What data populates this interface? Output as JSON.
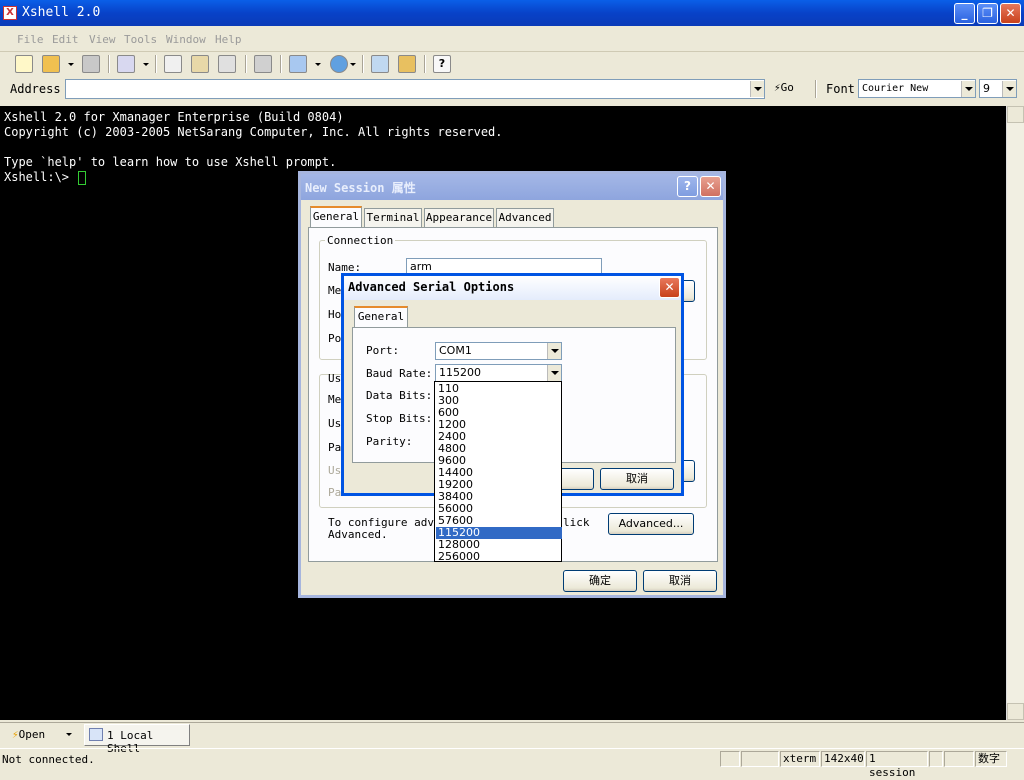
{
  "app": {
    "title": "Xshell 2.0"
  },
  "menu": [
    "File",
    "Edit",
    "View",
    "Tools",
    "Window",
    "Help"
  ],
  "address": {
    "label": "Address",
    "value": "",
    "go_label": "Go",
    "font_label": "Font",
    "font_value": "Courier New",
    "size_value": "9"
  },
  "terminal": {
    "lines": [
      "Xshell 2.0 for Xmanager Enterprise (Build 0804)",
      "Copyright (c) 2003-2005 NetSarang Computer, Inc. All rights reserved.",
      "",
      "Type `help' to learn how to use Xshell prompt.",
      "Xshell:\\> "
    ]
  },
  "session_dialog": {
    "title": "New Session 属性",
    "tabs": [
      "General",
      "Terminal",
      "Appearance",
      "Advanced"
    ],
    "connection_label": "Connection",
    "name_label": "Name:",
    "name_value": "arm",
    "trunc_labels": [
      "Me",
      "Ho",
      "Po",
      "Us",
      "Me",
      "Us",
      "Pa",
      "Us",
      "Pa"
    ],
    "configure_text_1": "To configure advan",
    "configure_text_2": "Advanced.",
    "configure_text_right": "lick",
    "advanced_button": "Advanced...",
    "ok_button": "确定",
    "cancel_button": "取消"
  },
  "serial_dialog": {
    "title": "Advanced Serial Options",
    "tab": "General",
    "port_label": "Port:",
    "port_value": "COM1",
    "baud_label": "Baud Rate:",
    "baud_value": "115200",
    "data_bits_label": "Data Bits:",
    "stop_bits_label": "Stop Bits:",
    "parity_label": "Parity:",
    "ok_partial": "E",
    "cancel_button": "取消",
    "baud_options": [
      "110",
      "300",
      "600",
      "1200",
      "2400",
      "4800",
      "9600",
      "14400",
      "19200",
      "38400",
      "56000",
      "57600",
      "115200",
      "128000",
      "256000"
    ],
    "baud_selected": "115200"
  },
  "tabsbar": {
    "open_label": "Open",
    "session_tab": "1 Local Shell"
  },
  "status": {
    "text": "Not connected.",
    "term": "xterm",
    "size": "142x40",
    "sessions": "1 session",
    "numlock": "数字"
  }
}
